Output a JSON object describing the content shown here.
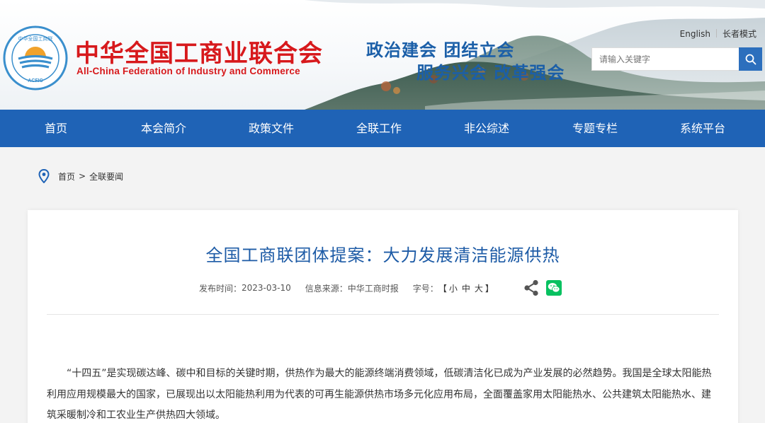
{
  "header": {
    "logo_cn": "中华全国工商业联合会",
    "logo_en": "All-China Federation of Industry and Commerce",
    "logo_ring_text_top": "中华全国工商联",
    "logo_ring_text_bottom": "ACFIC",
    "slogan_line1": "政治建会  团结立会",
    "slogan_line2": "服务兴会  改革强会",
    "lang_english": "English",
    "lang_elder": "长者模式",
    "search_placeholder": "请输入关键字",
    "brand_red": "#d7191c",
    "brand_blue": "#1f63b6"
  },
  "nav": {
    "items": [
      {
        "label": "首页"
      },
      {
        "label": "本会简介"
      },
      {
        "label": "政策文件"
      },
      {
        "label": "全联工作"
      },
      {
        "label": "非公综述"
      },
      {
        "label": "专题专栏"
      },
      {
        "label": "系统平台"
      }
    ]
  },
  "breadcrumb": {
    "home": "首页",
    "separator": ">",
    "current": "全联要闻"
  },
  "article": {
    "title": "全国工商联团体提案：大力发展清洁能源供热",
    "publish_label": "发布时间：",
    "publish_date": "2023-03-10",
    "source_label": "信息来源：",
    "source": "中华工商时报",
    "fontsize_label": "字号：",
    "bracket_open": "【",
    "font_small": "小",
    "font_medium": "中",
    "font_large": "大",
    "bracket_close": "】",
    "paragraph": "“十四五”是实现碳达峰、碳中和目标的关键时期，供热作为最大的能源终端消费领域，低碳清洁化已成为产业发展的必然趋势。我国是全球太阳能热利用应用规模最大的国家，已展现出以太阳能热利用为代表的可再生能源供热市场多元化应用布局，全面覆盖家用太阳能热水、公共建筑太阳能热水、建筑采暖制冷和工农业生产供热四大领域。"
  },
  "icons": {
    "location": "location-pin-icon",
    "search": "search-icon",
    "share": "share-icon",
    "wechat": "wechat-icon"
  }
}
